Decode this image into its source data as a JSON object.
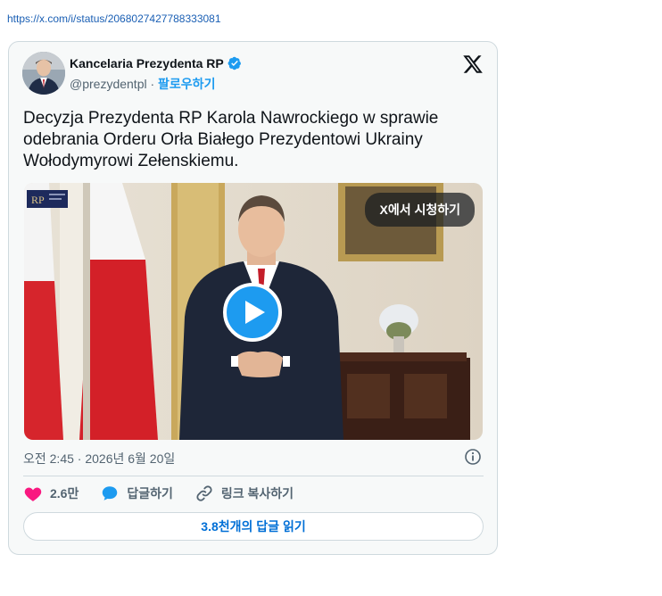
{
  "page": {
    "status_url": "https://x.com/i/status/2068027427788333081"
  },
  "tweet": {
    "author_name": "Kancelaria Prezydenta RP",
    "handle": "@prezydentpl",
    "separator": " · ",
    "follow_label": "팔로우하기",
    "text_lines": [
      "Decyzja Prezydenta RP Karola Nawrockiego w sprawie",
      "odebrania Orderu Orła Białego Prezydentowi Ukrainy",
      "Wołodymyrowi Zełenskiemu."
    ],
    "watch_on_x_label": "X에서 시청하기",
    "timestamp": "오전 2:45 · 2026년 6월 20일",
    "likes_count": "2.6만",
    "reply_label": "답글하기",
    "copy_link_label": "링크 복사하기",
    "read_replies_label": "3.8천개의 답글 읽기",
    "watermark_text": "RP"
  },
  "icons": {
    "verified": "verified-badge-icon",
    "x_logo": "x-logo-icon",
    "play": "play-icon",
    "info": "info-icon",
    "like": "heart-icon",
    "reply": "speech-bubble-icon",
    "link": "link-icon"
  },
  "colors": {
    "accent": "#1d9bf0",
    "like": "#f91880",
    "reply": "#1d9bf0",
    "link_text": "#006fd6"
  }
}
